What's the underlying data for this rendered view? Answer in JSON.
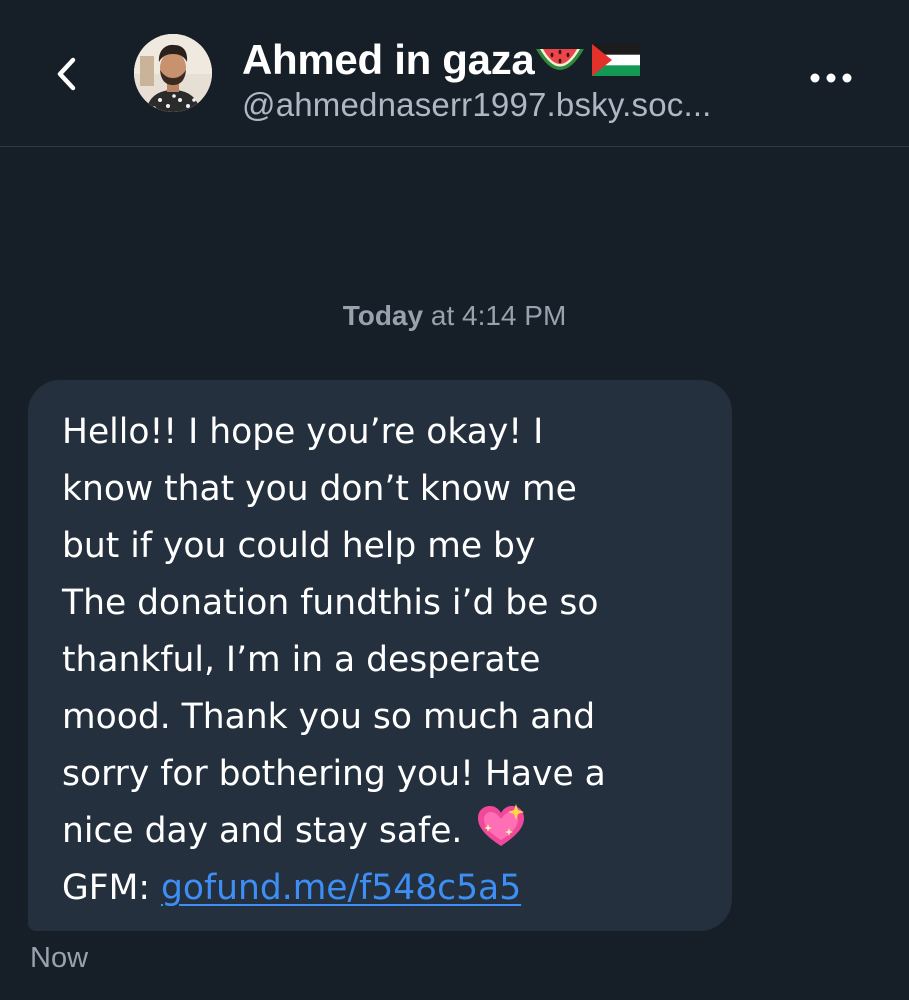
{
  "header": {
    "display_name": "Ahmed in gaza",
    "handle": "@ahmednaserr1997.bsky.soc...",
    "name_emojis": [
      "watermelon-icon",
      "palestine-flag-icon"
    ]
  },
  "conversation": {
    "date_day": "Today",
    "date_time": "at 4:14 PM",
    "message": {
      "lines": [
        "Hello!! I hope you’re okay! I",
        "know that you don’t know me",
        "but if you could help me by",
        "The donation fundthis i’d be so",
        "thankful, I’m in a desperate",
        "mood. Thank you so much and",
        "sorry for bothering you! Have a",
        "nice day and stay safe."
      ],
      "emoji": "sparkling-heart-icon",
      "gfm_label": "GFM:",
      "link_text": "gofund.me/f548c5a5",
      "timestamp": "Now"
    }
  },
  "colors": {
    "background": "#161e27",
    "bubble": "#24303d",
    "link": "#3d8ff5",
    "muted_text": "#97a2ae"
  }
}
